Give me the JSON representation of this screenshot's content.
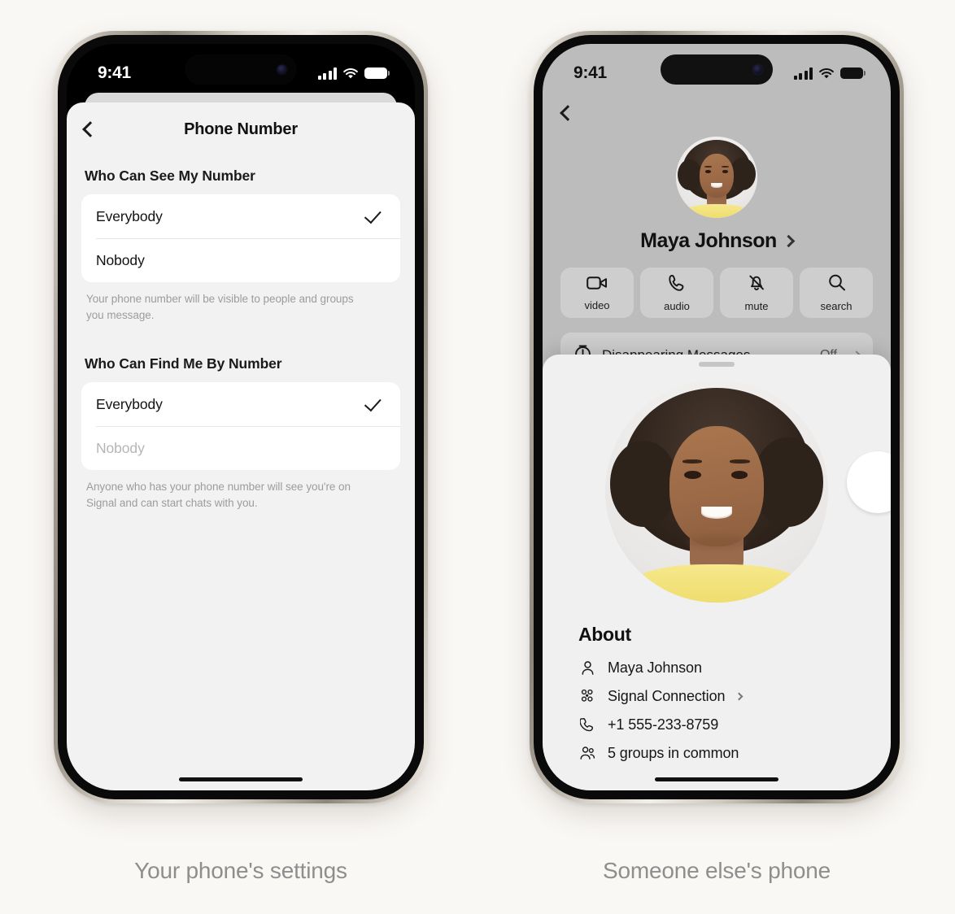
{
  "page": {
    "background_color": "#faf8f5"
  },
  "captions": {
    "left": "Your phone's settings",
    "right": "Someone else's phone"
  },
  "left_phone": {
    "status_bar": {
      "time": "9:41",
      "cellular_icon": "signal-bars-icon",
      "wifi_icon": "wifi-icon",
      "battery_icon": "battery-icon"
    },
    "nav": {
      "back_icon": "chevron-left-icon",
      "title": "Phone Number"
    },
    "sections": [
      {
        "header": "Who Can See My Number",
        "options": [
          {
            "label": "Everybody",
            "selected": true,
            "disabled": false
          },
          {
            "label": "Nobody",
            "selected": false,
            "disabled": false
          }
        ],
        "footnote": "Your phone number will be visible to people and groups you message."
      },
      {
        "header": "Who Can Find Me By Number",
        "options": [
          {
            "label": "Everybody",
            "selected": true,
            "disabled": false
          },
          {
            "label": "Nobody",
            "selected": false,
            "disabled": true
          }
        ],
        "footnote": "Anyone who has your phone number will see you're on Signal and can start chats with you."
      }
    ],
    "check_icon": "checkmark-icon"
  },
  "right_phone": {
    "status_bar": {
      "time": "9:41",
      "cellular_icon": "signal-bars-icon",
      "wifi_icon": "wifi-icon",
      "battery_icon": "battery-icon"
    },
    "nav": {
      "back_icon": "chevron-left-icon"
    },
    "profile": {
      "avatar_name": "contact-avatar",
      "name": "Maya Johnson",
      "name_chevron_icon": "chevron-right-icon"
    },
    "actions": [
      {
        "label": "video",
        "icon": "video-camera-icon"
      },
      {
        "label": "audio",
        "icon": "phone-icon"
      },
      {
        "label": "mute",
        "icon": "bell-slash-icon"
      },
      {
        "label": "search",
        "icon": "search-icon"
      }
    ],
    "disappearing_messages": {
      "icon": "timer-icon",
      "label": "Disappearing Messages",
      "value": "Off",
      "chevron_icon": "chevron-right-icon"
    },
    "sheet": {
      "grabber": "sheet-drag-handle",
      "avatar_name": "contact-avatar-large",
      "about_title": "About",
      "rows": [
        {
          "icon": "person-icon",
          "text": "Maya Johnson",
          "chevron": false
        },
        {
          "icon": "signal-connection-icon",
          "text": "Signal Connection",
          "chevron": true
        },
        {
          "icon": "phone-icon",
          "text": "+1 555-233-8759",
          "chevron": false
        },
        {
          "icon": "groups-icon",
          "text": "5 groups in common",
          "chevron": false
        }
      ]
    }
  }
}
